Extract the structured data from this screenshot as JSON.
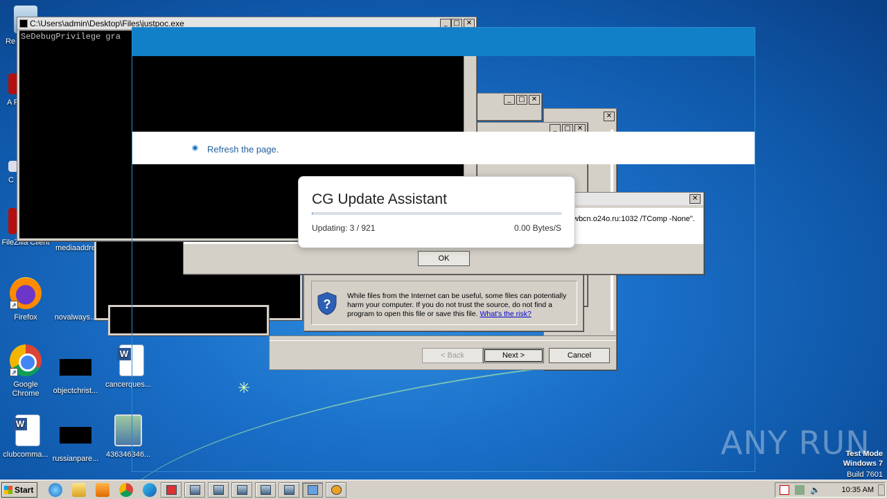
{
  "desktop": {
    "icons_left": [
      {
        "label": "Re",
        "name": "recycle-bin-icon"
      },
      {
        "label": "A Re",
        "name": "acrobat-reader-icon"
      },
      {
        "label": "C",
        "name": "ccleaner-icon"
      },
      {
        "label": "FileZilla Client",
        "name": "filezilla-icon"
      },
      {
        "label": "Firefox",
        "name": "firefox-icon"
      },
      {
        "label": "Google Chrome",
        "name": "chrome-icon"
      },
      {
        "label": "clubcomma...",
        "name": "word-doc-icon"
      }
    ],
    "icons_mid": [
      {
        "label": "mediaaddre",
        "name": "file-icon"
      },
      {
        "label": "novalways...",
        "name": "file-icon"
      },
      {
        "label": "objectchrist...",
        "name": "file-icon"
      },
      {
        "label": "russianpare...",
        "name": "file-icon"
      }
    ],
    "icons_right": [
      {
        "label": "cancerques...",
        "name": "word-doc-icon"
      },
      {
        "label": "436346346...",
        "name": "setup-exe-icon"
      }
    ]
  },
  "console": {
    "title": "C:\\Users\\admin\\Desktop\\Files\\justpoc.exe",
    "output": "SeDebugPrivilege gra"
  },
  "window_buttons": {
    "minimize": "_",
    "maximize": "□",
    "close": "✕"
  },
  "error_dialog": {
    "message_fragment": "wbcn.o24o.ru:1032 /TComp -None\".",
    "ok_label": "OK"
  },
  "download_warning": {
    "text_line1": "While files from the Internet can be useful, some files can potentially",
    "text_line2": "harm your computer. If you do not trust the source, do not find a",
    "text_line3": "program to open this file or save this file.",
    "risk_link": "What's the risk?"
  },
  "wizard": {
    "back_label": "< Back",
    "next_label": "Next >",
    "cancel_label": "Cancel"
  },
  "overlay": {
    "refresh_text": "Refresh the page.",
    "colors": {
      "header": "#1180c8",
      "accent_text": "#1f5e9e"
    }
  },
  "cg_dialog": {
    "title": "CG Update Assistant",
    "status": "Updating: 3 / 921",
    "speed": "0.00 Bytes/S",
    "progress_fraction": 0.0033
  },
  "taskbar": {
    "start_label": "Start",
    "clock": "10:35 AM"
  },
  "watermark": {
    "line1": "Test Mode",
    "line2": "Windows 7",
    "line3": "Build 7601",
    "brand": "ANY RUN"
  }
}
